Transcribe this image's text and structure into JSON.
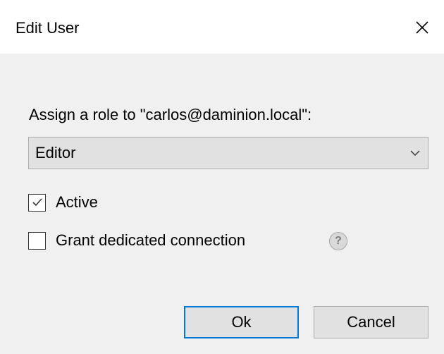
{
  "window": {
    "title": "Edit User",
    "close_icon": "close-icon"
  },
  "form": {
    "prompt": "Assign a role to \"carlos@daminion.local\":",
    "role_select": {
      "value": "Editor",
      "arrow_icon": "chevron-down-icon"
    },
    "checkboxes": [
      {
        "label": "Active",
        "checked": true
      },
      {
        "label": "Grant dedicated connection",
        "checked": false
      }
    ],
    "help_glyph": "?"
  },
  "buttons": {
    "ok_label": "Ok",
    "cancel_label": "Cancel"
  },
  "colors": {
    "accent": "#0078d7",
    "dialog_bg": "#f0f0f0",
    "button_bg": "#e1e1e1"
  }
}
